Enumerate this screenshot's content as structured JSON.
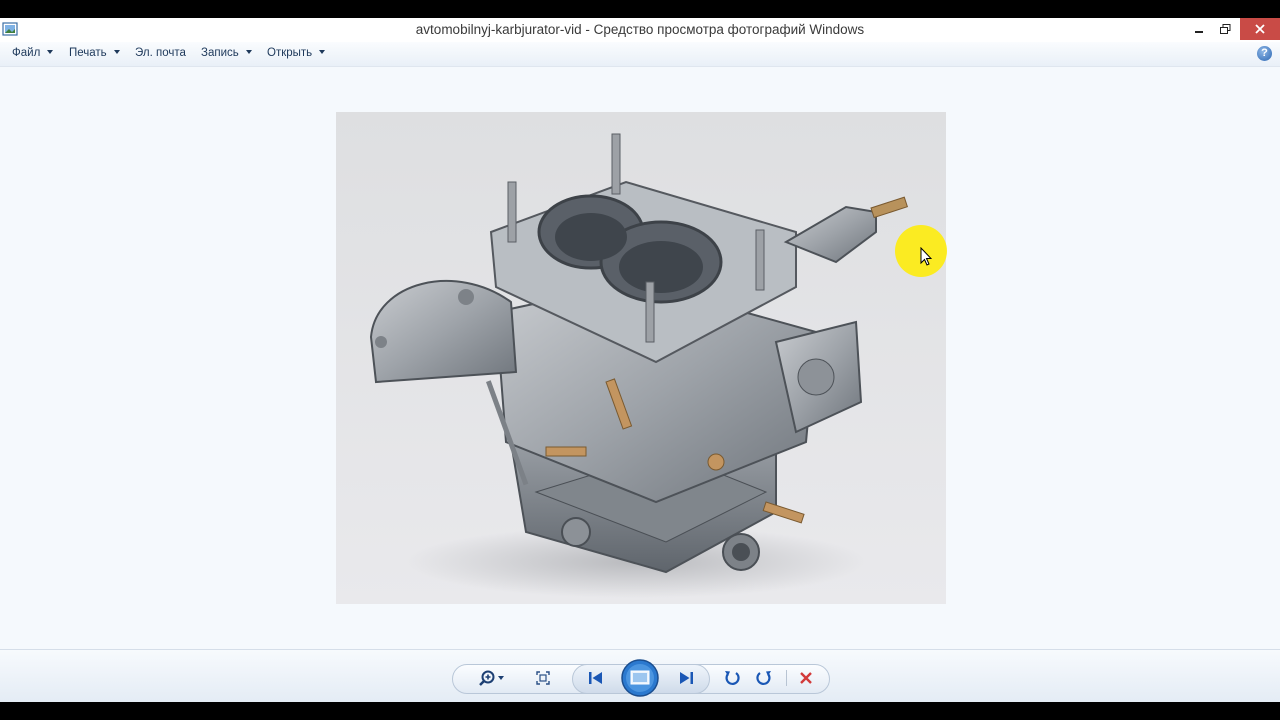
{
  "window": {
    "title": "avtomobilnyj-karbjurator-vid - Средство просмотра фотографий Windows",
    "minimize_icon": "minimize-icon",
    "maximize_icon": "restore-icon",
    "close_icon": "close-icon"
  },
  "menu": {
    "items": [
      {
        "label": "Файл",
        "dropdown": true
      },
      {
        "label": "Печать",
        "dropdown": true
      },
      {
        "label": "Эл. почта",
        "dropdown": false
      },
      {
        "label": "Запись",
        "dropdown": true
      },
      {
        "label": "Открыть",
        "dropdown": true
      }
    ],
    "help_label": "?"
  },
  "controls": [
    {
      "name": "zoom",
      "icon": "zoom-icon"
    },
    {
      "name": "actual-size",
      "icon": "fit-window-icon"
    },
    {
      "name": "previous",
      "icon": "previous-icon"
    },
    {
      "name": "slideshow",
      "icon": "slideshow-icon"
    },
    {
      "name": "next",
      "icon": "next-icon"
    },
    {
      "name": "rotate-left",
      "icon": "rotate-counterclockwise-icon"
    },
    {
      "name": "rotate-right",
      "icon": "rotate-clockwise-icon"
    },
    {
      "name": "delete",
      "icon": "delete-icon"
    }
  ],
  "colors": {
    "accent": "#2c67b3",
    "close_button": "#c94b46",
    "delete_red": "#d23a3a"
  }
}
